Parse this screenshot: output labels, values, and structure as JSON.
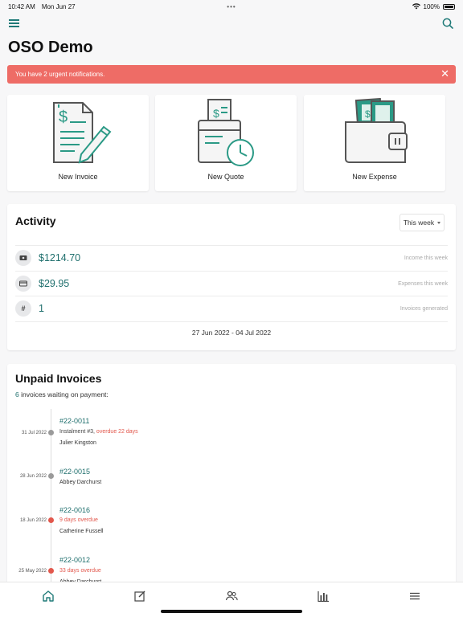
{
  "status": {
    "time": "10:42 AM",
    "date": "Mon Jun 27",
    "dots": "•••",
    "battery": "100%"
  },
  "nav": {
    "menu_icon": "hamburger-icon",
    "search_icon": "search-icon"
  },
  "page": {
    "title": "OSO Demo"
  },
  "alert": {
    "text": "You have 2 urgent notifications.",
    "close": "✕",
    "color": "#ee6c66"
  },
  "quick_actions": [
    {
      "label": "New Invoice",
      "icon": "invoice-icon"
    },
    {
      "label": "New Quote",
      "icon": "quote-icon"
    },
    {
      "label": "New Expense",
      "icon": "wallet-icon"
    }
  ],
  "activity": {
    "title": "Activity",
    "period": "This week",
    "stats": [
      {
        "icon": "income-icon",
        "value": "$1214.70",
        "caption": "Income this week"
      },
      {
        "icon": "card-icon",
        "value": "$29.95",
        "caption": "Expenses this week"
      },
      {
        "icon": "hash-icon",
        "glyph": "#",
        "value": "1",
        "caption": "Invoices generated"
      }
    ],
    "range": "27 Jun 2022 - 04 Jul 2022"
  },
  "unpaid": {
    "title": "Unpaid Invoices",
    "count": "6",
    "waiting_text": " invoices waiting on payment:",
    "items": [
      {
        "date": "31 Jul 2022",
        "number": "#22-0011",
        "prefix": "Instalment #3, ",
        "status": "overdue 22 days",
        "name": "Julier Kingston",
        "dot": "#9a9a9a"
      },
      {
        "date": "28 Jun 2022",
        "number": "#22-0015",
        "prefix": "",
        "status": "",
        "name": "Abbey Darchurst",
        "dot": "#9a9a9a"
      },
      {
        "date": "18 Jun 2022",
        "number": "#22-0016",
        "prefix": "",
        "status": "9 days overdue",
        "name": "Catherine Fussell",
        "dot": "#e2574c"
      },
      {
        "date": "25 May 2022",
        "number": "#22-0012",
        "prefix": "",
        "status": "33 days overdue",
        "name": "Abbey Darchurst",
        "dot": "#e2574c"
      }
    ]
  },
  "tabs": [
    {
      "icon": "home-icon"
    },
    {
      "icon": "edit-icon"
    },
    {
      "icon": "users-icon"
    },
    {
      "icon": "chart-icon"
    },
    {
      "icon": "menu-icon"
    }
  ],
  "colors": {
    "accent": "#1f7a78",
    "danger": "#e2574c"
  }
}
